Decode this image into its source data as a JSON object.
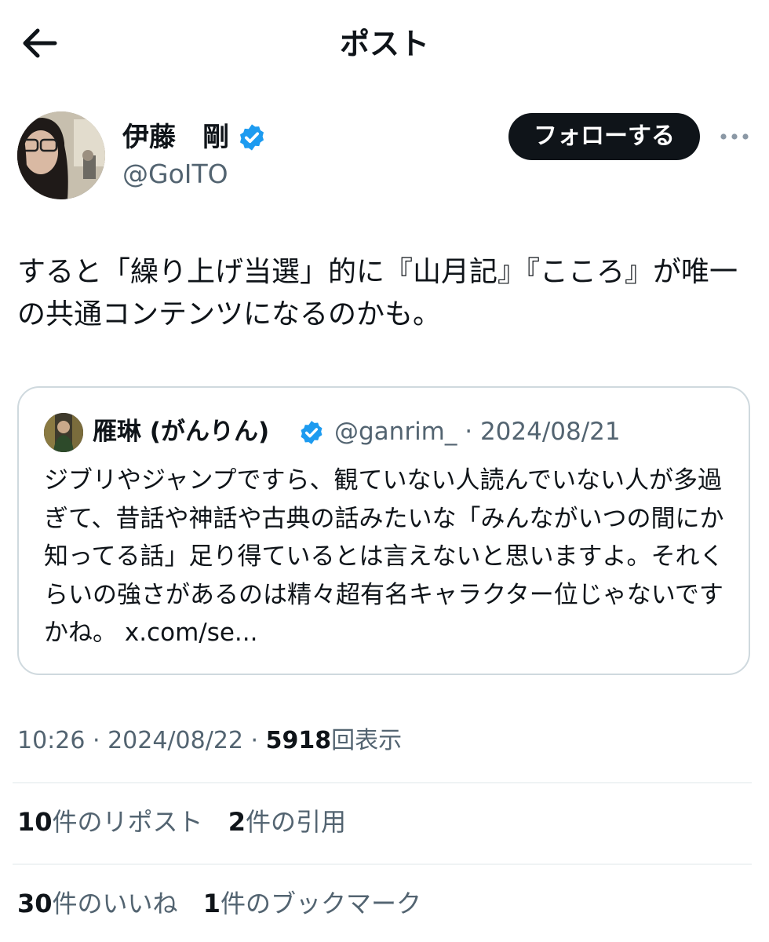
{
  "header": {
    "title": "ポスト",
    "back_icon": "arrow-left-icon"
  },
  "author": {
    "name": "伊藤　剛",
    "handle": "@GoITO",
    "verified": true,
    "verified_color": "#1d9bf0"
  },
  "follow_button": {
    "label": "フォローする"
  },
  "more_icon": "more-horizontal-icon",
  "post": {
    "text": "すると「繰り上げ当選」的に『山月記』『こころ』が唯一の共通コンテンツになるのかも。"
  },
  "quote": {
    "name": "雁琳 (がんりん)",
    "handle": "@ganrim_",
    "separator": " · ",
    "date": "2024/08/21",
    "text": "ジブリやジャンプですら、観ていない人読んでいない人が多過ぎて、昔話や神話や古典の話みたいな「みんながいつの間にか知ってる話」足り得ているとは言えないと思いますよ。それくらいの強さがあるのは精々超有名キャラクター位じゃないですかね。",
    "link": "x.com/se..."
  },
  "meta": {
    "time": "10:26",
    "date": "2024/08/22",
    "separator": " · ",
    "views": "5918",
    "views_label": "回表示"
  },
  "stats": {
    "reposts": {
      "count": "10",
      "label": "件のリポスト"
    },
    "quotes": {
      "count": "2",
      "label": "件の引用"
    },
    "likes": {
      "count": "30",
      "label": "件のいいね"
    },
    "bookmarks": {
      "count": "1",
      "label": "件のブックマーク"
    }
  },
  "colors": {
    "text_primary": "#0f1419",
    "text_secondary": "#536471",
    "border": "#cfd9de",
    "divider": "#eff3f4"
  }
}
